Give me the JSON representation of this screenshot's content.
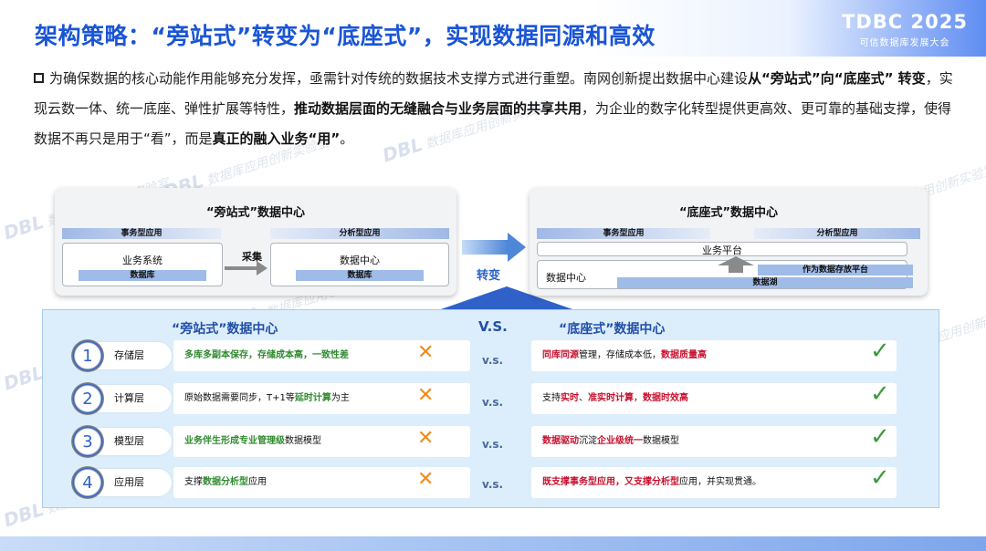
{
  "title": "架构策略：“旁站式”转变为“底座式”，实现数据同源和高效",
  "brand": {
    "name": "TDBC 2025",
    "subtitle": "可信数据库发展大会"
  },
  "watermark": {
    "logo": "DBL",
    "text": "数据库应用创新实验室"
  },
  "intro": {
    "p1": "为确保数据的核心动能作用能够充分发挥，亟需针对传统的数据技术支撑方式进行重塑。南网创新提出数据中心建设",
    "b1": "从“旁站式”向“底座式” 转变",
    "p2": "，实现云数一体、统一底座、弹性扩展等特性，",
    "b2": "推动数据层面的无缝融合与业务层面的共享共用",
    "p3": "，为企业的数字化转型提供更高效、更可靠的基础支撑，使得数据不再只是用于“看”，而是",
    "b3": "真正的融入业务“用”",
    "p4": "。"
  },
  "left_diagram": {
    "title": "“旁站式”数据中心",
    "business_app": "事务型应用",
    "analytic_app": "分析型应用",
    "business_system": "业务系统",
    "database_a": "数据库",
    "collect": "采集",
    "data_center": "数据中心",
    "database_b": "数据库"
  },
  "transform_label": "转变",
  "right_diagram": {
    "title": "“底座式”数据中心",
    "business_app": "事务型应用",
    "analytic_app": "分析型应用",
    "business_platform": "业务平台",
    "data_center": "数据中心",
    "storage_platform": "作为数据存放平台",
    "data_lake": "数据湖"
  },
  "compare": {
    "left_head": "“旁站式”数据中心",
    "vs_head": "V.S.",
    "right_head": "“底座式”数据中心",
    "rows": [
      {
        "num": "1",
        "layer": "存储层",
        "left": {
          "a": "多库多副本保存，存储成本高，一致性差",
          "b": "",
          "c": "",
          "d": ""
        },
        "vs": "v.s.",
        "right": {
          "a": "同库同源",
          "b": "管理，存储",
          "c": "成本低",
          "d": "，",
          "e": "数据质量高"
        }
      },
      {
        "num": "2",
        "layer": "计算层",
        "left": {
          "a": "原始数据需要同步，T+1等",
          "b": "延时计算",
          "c": "为主"
        },
        "vs": "v.s.",
        "right": {
          "a": "支持",
          "b": "实时",
          "c": "、",
          "d": "准实时计算",
          "e": "，",
          "f": "数据时效高"
        }
      },
      {
        "num": "3",
        "layer": "模型层",
        "left": {
          "a": "业务伴生形成专业管理级",
          "b": "数据模型"
        },
        "vs": "v.s.",
        "right": {
          "a": "数据驱动",
          "b": "沉淀",
          "c": "企业级统一",
          "d": "数据模型"
        }
      },
      {
        "num": "4",
        "layer": "应用层",
        "left": {
          "a": "支撑",
          "b": "数据分析型",
          "c": "应用"
        },
        "vs": "v.s.",
        "right": {
          "a": "既支撑事务型应用，又支撑分析型",
          "b": "应用，并实现贯通。"
        }
      }
    ],
    "bad_mark": "✕",
    "good_mark": "✓"
  }
}
